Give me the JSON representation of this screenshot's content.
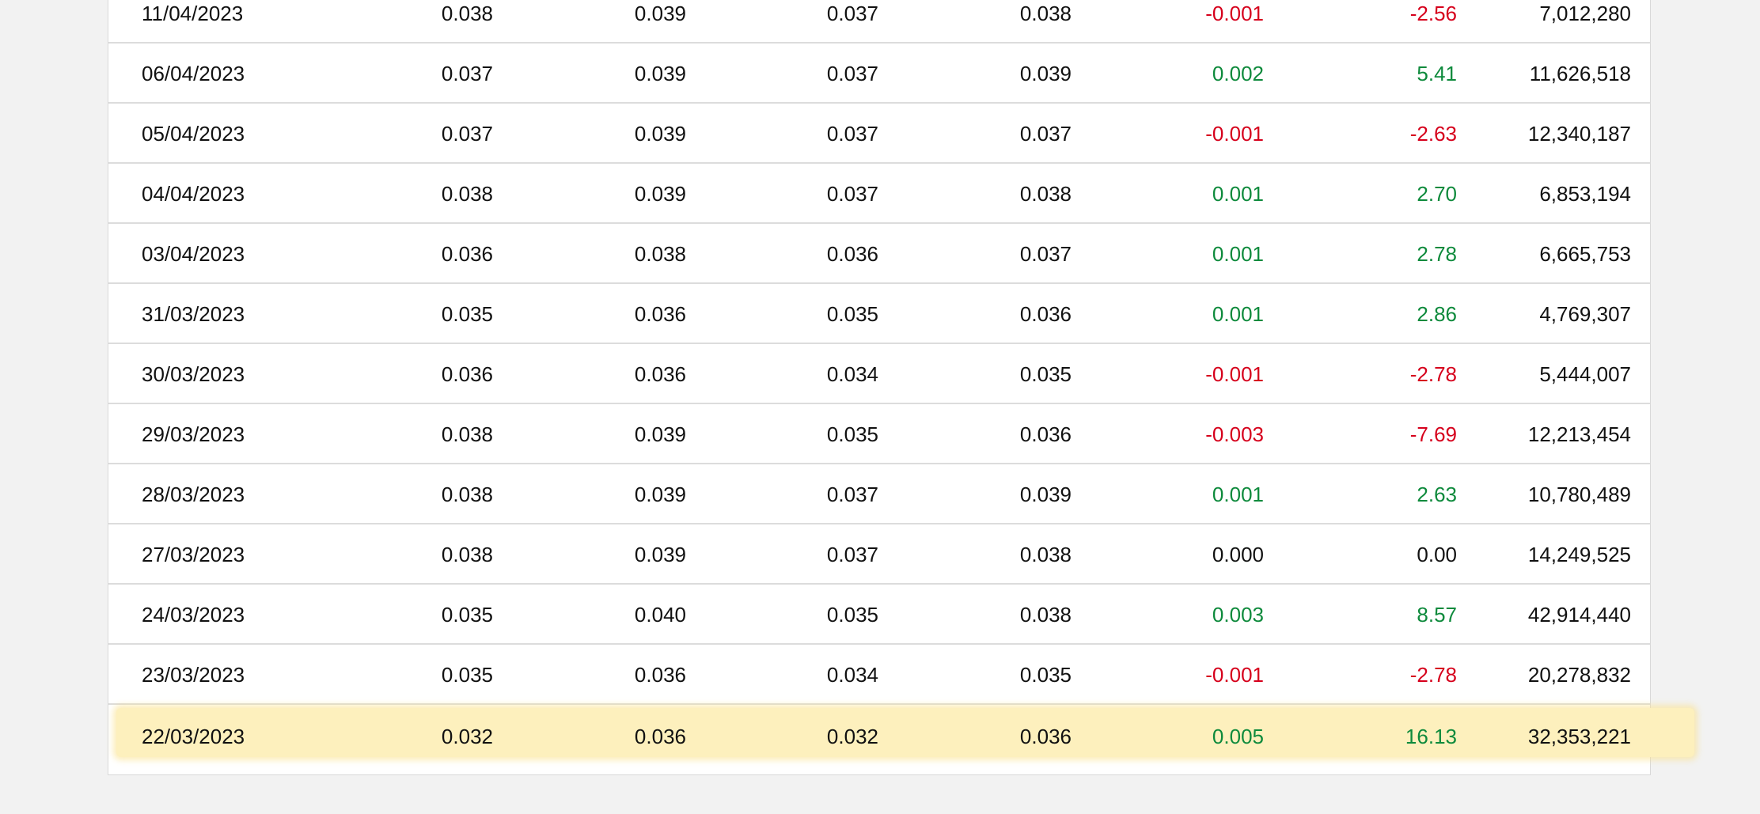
{
  "colors": {
    "positive": "#0e8a3c",
    "negative": "#d6001c",
    "highlight": "#fdf0bd"
  },
  "rows": [
    {
      "date": "11/04/2023",
      "open": "0.038",
      "high": "0.039",
      "low": "0.037",
      "close": "0.038",
      "change": "-0.001",
      "pct": "-2.56",
      "volume": "7,012,280",
      "trend": "neg"
    },
    {
      "date": "06/04/2023",
      "open": "0.037",
      "high": "0.039",
      "low": "0.037",
      "close": "0.039",
      "change": "0.002",
      "pct": "5.41",
      "volume": "11,626,518",
      "trend": "pos"
    },
    {
      "date": "05/04/2023",
      "open": "0.037",
      "high": "0.039",
      "low": "0.037",
      "close": "0.037",
      "change": "-0.001",
      "pct": "-2.63",
      "volume": "12,340,187",
      "trend": "neg"
    },
    {
      "date": "04/04/2023",
      "open": "0.038",
      "high": "0.039",
      "low": "0.037",
      "close": "0.038",
      "change": "0.001",
      "pct": "2.70",
      "volume": "6,853,194",
      "trend": "pos"
    },
    {
      "date": "03/04/2023",
      "open": "0.036",
      "high": "0.038",
      "low": "0.036",
      "close": "0.037",
      "change": "0.001",
      "pct": "2.78",
      "volume": "6,665,753",
      "trend": "pos"
    },
    {
      "date": "31/03/2023",
      "open": "0.035",
      "high": "0.036",
      "low": "0.035",
      "close": "0.036",
      "change": "0.001",
      "pct": "2.86",
      "volume": "4,769,307",
      "trend": "pos"
    },
    {
      "date": "30/03/2023",
      "open": "0.036",
      "high": "0.036",
      "low": "0.034",
      "close": "0.035",
      "change": "-0.001",
      "pct": "-2.78",
      "volume": "5,444,007",
      "trend": "neg"
    },
    {
      "date": "29/03/2023",
      "open": "0.038",
      "high": "0.039",
      "low": "0.035",
      "close": "0.036",
      "change": "-0.003",
      "pct": "-7.69",
      "volume": "12,213,454",
      "trend": "neg"
    },
    {
      "date": "28/03/2023",
      "open": "0.038",
      "high": "0.039",
      "low": "0.037",
      "close": "0.039",
      "change": "0.001",
      "pct": "2.63",
      "volume": "10,780,489",
      "trend": "pos"
    },
    {
      "date": "27/03/2023",
      "open": "0.038",
      "high": "0.039",
      "low": "0.037",
      "close": "0.038",
      "change": "0.000",
      "pct": "0.00",
      "volume": "14,249,525",
      "trend": "neu"
    },
    {
      "date": "24/03/2023",
      "open": "0.035",
      "high": "0.040",
      "low": "0.035",
      "close": "0.038",
      "change": "0.003",
      "pct": "8.57",
      "volume": "42,914,440",
      "trend": "pos"
    },
    {
      "date": "23/03/2023",
      "open": "0.035",
      "high": "0.036",
      "low": "0.034",
      "close": "0.035",
      "change": "-0.001",
      "pct": "-2.78",
      "volume": "20,278,832",
      "trend": "neg"
    },
    {
      "date": "22/03/2023",
      "open": "0.032",
      "high": "0.036",
      "low": "0.032",
      "close": "0.036",
      "change": "0.005",
      "pct": "16.13",
      "volume": "32,353,221",
      "trend": "pos",
      "highlighted": true
    }
  ]
}
